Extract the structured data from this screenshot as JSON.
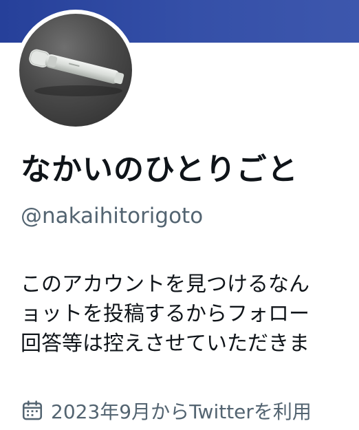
{
  "profile": {
    "display_name": "なかいのひとりごと",
    "handle": "@nakaihitorigoto",
    "bio_lines": [
      "このアカウントを見つけるなん",
      "ョットを投稿するからフォロー",
      "回答等は控えさせていただきま"
    ],
    "joined_text": "2023年9月からTwitterを利用"
  },
  "icons": {
    "calendar": "calendar-icon",
    "avatar": "microphone-photo"
  },
  "colors": {
    "banner": "#3550a8",
    "name": "#0f1419",
    "secondary": "#536471"
  }
}
